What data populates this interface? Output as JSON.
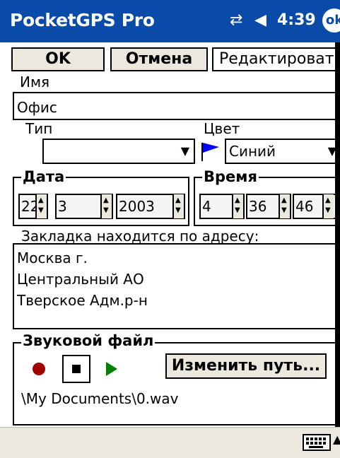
{
  "title_bar": {
    "app_title": "PocketGPS Pro",
    "time": "4:39",
    "ok_label": "ok"
  },
  "toolbar": {
    "ok_label": "OK",
    "cancel_label": "Отмена",
    "edit_label": "Редактировать"
  },
  "name": {
    "label": "Имя",
    "value": "Офис"
  },
  "type": {
    "label": "Тип",
    "value": ""
  },
  "color": {
    "label": "Цвет",
    "value": "Синий",
    "flag_color": "#0000ff"
  },
  "date": {
    "title": "Дата",
    "day": "22",
    "month": "3",
    "year": "2003"
  },
  "time": {
    "title": "Время",
    "hour": "4",
    "minute": "36",
    "second": "46"
  },
  "address": {
    "label": "Закладка находится по адресу:",
    "lines": [
      "Москва г.",
      "Центральный АО",
      "Тверское Адм.р-н"
    ]
  },
  "sound": {
    "title": "Звуковой файл",
    "change_path_label": "Изменить путь...",
    "path": "\\My Documents\\0.wav"
  },
  "colors": {
    "title_bar": "#0a4aa8",
    "record": "#a00000",
    "play": "#008000"
  }
}
